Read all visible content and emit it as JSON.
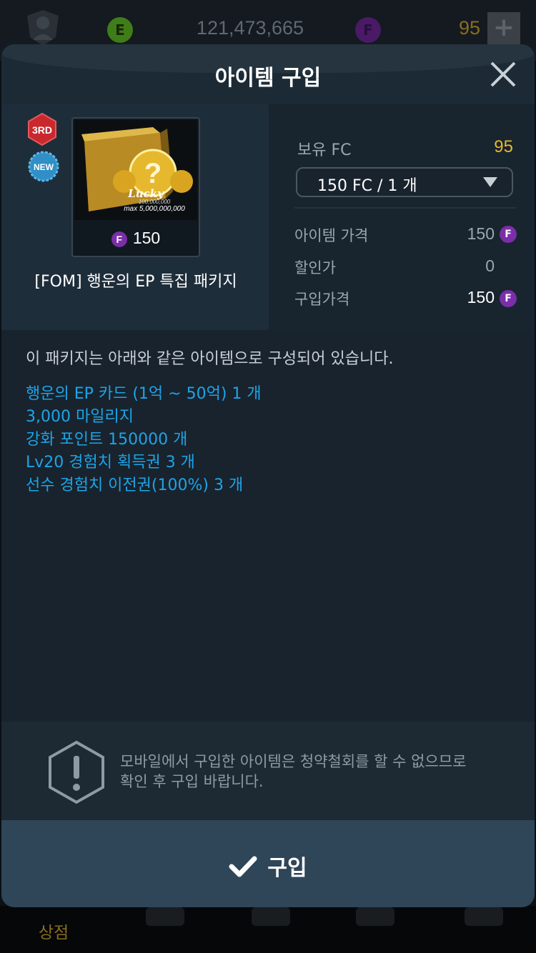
{
  "top_bar": {
    "ep_label": "E",
    "ep_balance": "121,473,665",
    "fc_label": "F",
    "fc_balance": "95",
    "add_button": "+"
  },
  "modal": {
    "title": "아이템 구입",
    "badges": [
      "3RD",
      "NEW"
    ],
    "item": {
      "name": "[FOM] 행운의 EP 특집 패키지",
      "price": "150",
      "currency": "F",
      "image_text": {
        "lucky": "Lucky",
        "range_top": "100,000,000",
        "max": "max 5,000,000,000"
      }
    },
    "owned": {
      "label": "보유 FC",
      "value": "95"
    },
    "quantity_select": {
      "selected": "150 FC / 1 개"
    },
    "price_rows": [
      {
        "label": "아이템 가격",
        "value": "150",
        "currency": "F"
      },
      {
        "label": "할인가",
        "value": "0"
      },
      {
        "label": "구입가격",
        "value": "150",
        "currency": "F"
      }
    ],
    "description": "이 패키지는 아래와 같은 아이템으로 구성되어 있습니다.",
    "contents": [
      "행운의 EP 카드 (1억 ~ 50억) 1 개",
      "3,000 마일리지",
      "강화 포인트 150000 개",
      "Lv20 경험치 획득권 3 개",
      "선수 경험치 이전권(100%) 3 개"
    ],
    "notice": {
      "line1": "모바일에서 구입한 아이템은 청약철회를 할 수 없으므로",
      "line2": "확인 후 구입 바랍니다."
    },
    "buy_button": "구입"
  },
  "bottom_nav": {
    "active_label": "상점"
  },
  "colors": {
    "accent_gold": "#e8b92a",
    "accent_blue": "#1ea4e6",
    "fc_purple": "#7a2ea8",
    "ep_green": "#3f7d18"
  }
}
